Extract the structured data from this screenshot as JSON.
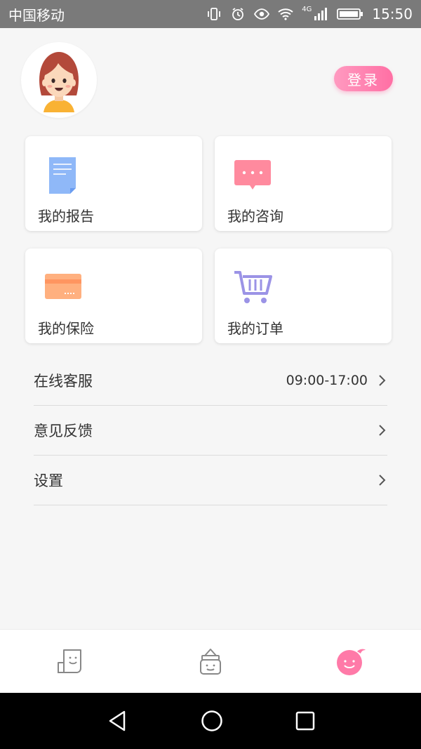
{
  "status_bar": {
    "carrier": "中国移动",
    "network": "4G",
    "time": "15:50",
    "icons": [
      "vibrate-icon",
      "alarm-icon",
      "eye-icon",
      "wifi-icon",
      "signal-icon",
      "battery-icon"
    ]
  },
  "header": {
    "avatar_icon": "avatar-girl-icon",
    "login_label": "登录"
  },
  "cards": [
    {
      "id": "report",
      "label": "我的报告",
      "icon": "report-document-icon",
      "color": "#8fb8f8"
    },
    {
      "id": "consult",
      "label": "我的咨询",
      "icon": "chat-bubble-icon",
      "color": "#ff8a9e"
    },
    {
      "id": "insurance",
      "label": "我的保险",
      "icon": "card-icon",
      "color": "#ffb07f"
    },
    {
      "id": "order",
      "label": "我的订单",
      "icon": "cart-icon",
      "color": "#9b93e6"
    }
  ],
  "list": [
    {
      "label": "在线客服",
      "value": "09:00-17:00"
    },
    {
      "label": "意见反馈",
      "value": ""
    },
    {
      "label": "设置",
      "value": ""
    }
  ],
  "tabs": [
    {
      "id": "home",
      "icon": "smile-doc-icon",
      "active": false
    },
    {
      "id": "shop",
      "icon": "bottle-icon",
      "active": false
    },
    {
      "id": "me",
      "icon": "pink-face-icon",
      "active": true
    }
  ],
  "colors": {
    "accent": "#ff7aa8",
    "background": "#f6f6f6",
    "status_bar": "#7a7a7a"
  }
}
